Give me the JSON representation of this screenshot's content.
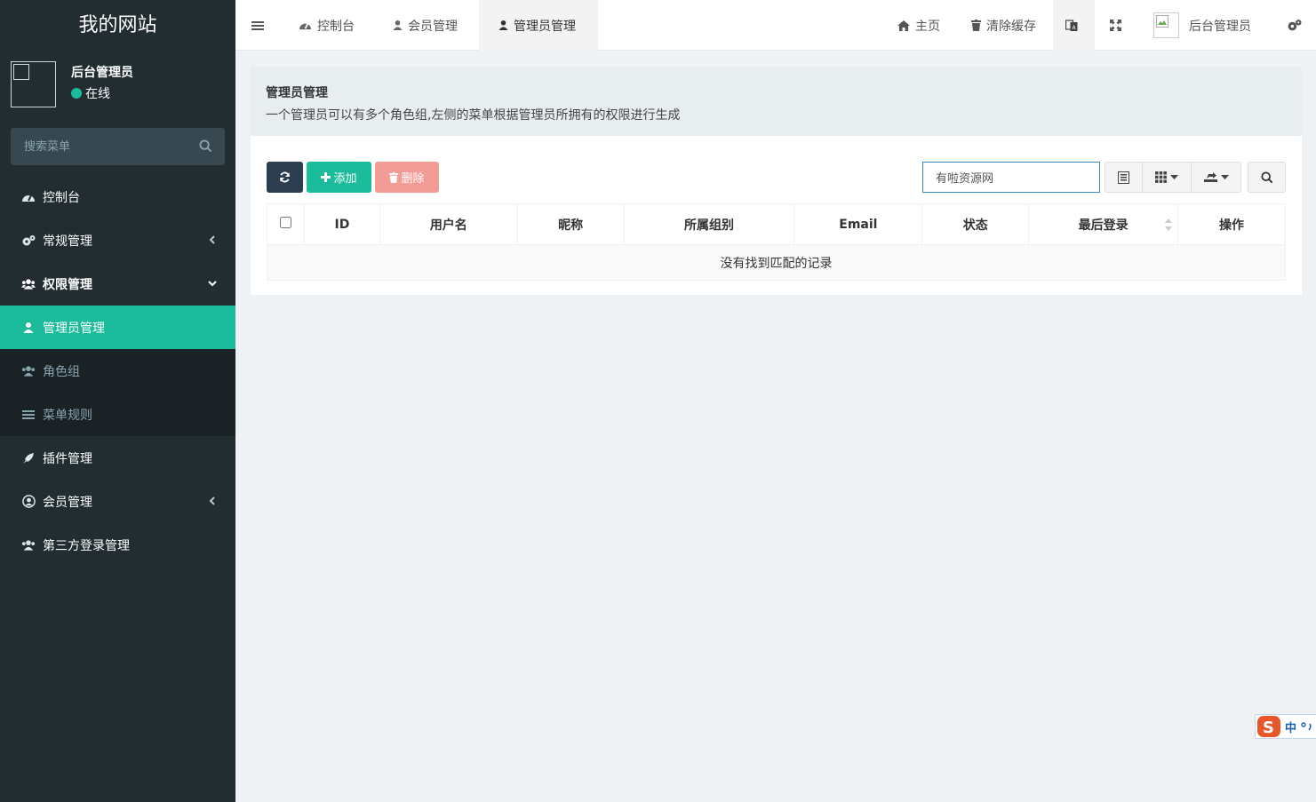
{
  "sidebar": {
    "brand": "我的网站",
    "user": {
      "name": "后台管理员",
      "status": "在线"
    },
    "search_placeholder": "搜索菜单",
    "items": [
      {
        "label": "控制台",
        "icon": "dashboard-icon"
      },
      {
        "label": "常规管理",
        "icon": "cogs-icon",
        "arrow": "chevron-left-icon"
      },
      {
        "label": "权限管理",
        "icon": "group-icon",
        "arrow": "chevron-down-icon"
      },
      {
        "label": "管理员管理",
        "icon": "user-icon",
        "active": true
      },
      {
        "label": "角色组",
        "icon": "group-icon"
      },
      {
        "label": "菜单规则",
        "icon": "bars-icon"
      },
      {
        "label": "插件管理",
        "icon": "rocket-icon"
      },
      {
        "label": "会员管理",
        "icon": "user-circle-icon",
        "arrow": "chevron-left-icon"
      },
      {
        "label": "第三方登录管理",
        "icon": "group-icon"
      }
    ]
  },
  "header": {
    "tabs": [
      {
        "label": "控制台",
        "icon": "dashboard-icon"
      },
      {
        "label": "会员管理",
        "icon": "user-icon"
      },
      {
        "label": "管理员管理",
        "icon": "user-icon",
        "active": true
      }
    ],
    "home": "主页",
    "clear_cache": "清除缓存",
    "user_name": "后台管理员"
  },
  "panel": {
    "title": "管理员管理",
    "description": "一个管理员可以有多个角色组,左侧的菜单根据管理员所拥有的权限进行生成"
  },
  "toolbar": {
    "add_label": "添加",
    "delete_label": "删除",
    "search_value": "有啦资源网"
  },
  "table": {
    "columns": [
      "ID",
      "用户名",
      "昵称",
      "所属组别",
      "Email",
      "状态",
      "最后登录",
      "操作"
    ],
    "empty_text": "没有找到匹配的记录"
  },
  "ime": {
    "label": "中"
  },
  "colors": {
    "sidebar": "#222d32",
    "accent": "#1bbc9b",
    "danger": "#f39c96",
    "dark_btn": "#2c3e50"
  }
}
